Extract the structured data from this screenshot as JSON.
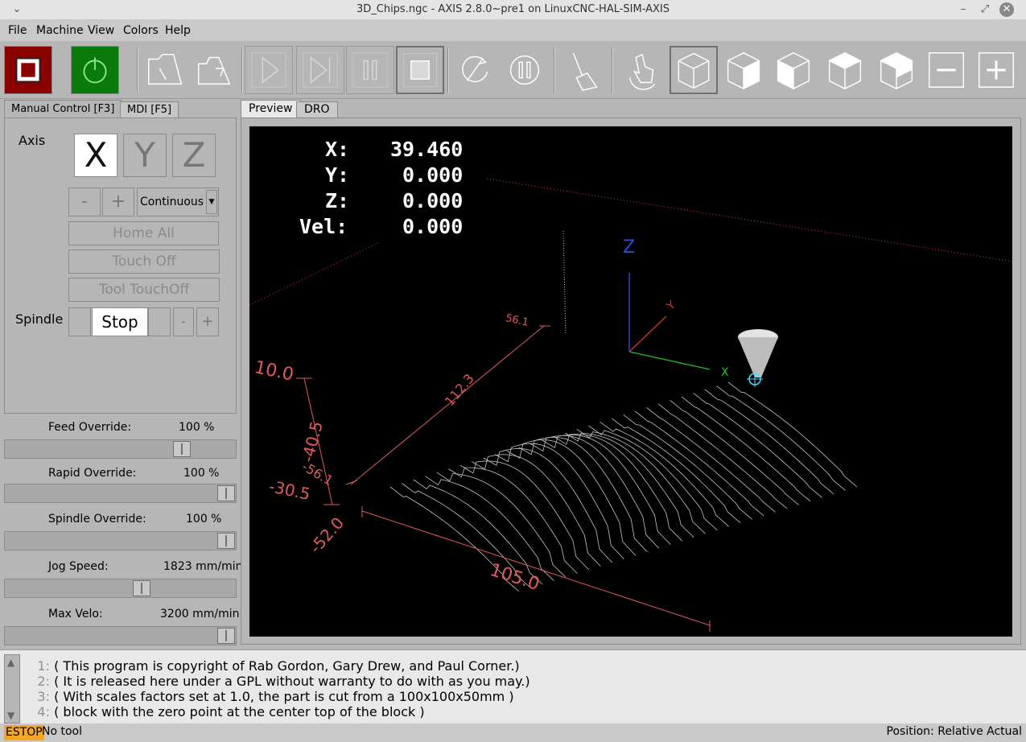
{
  "window": {
    "title": "3D_Chips.ngc - AXIS 2.8.0~pre1 on LinuxCNC-HAL-SIM-AXIS"
  },
  "menu": [
    {
      "label": "File"
    },
    {
      "label": "Machine"
    },
    {
      "label": "View"
    },
    {
      "label": "Colors"
    },
    {
      "label": "Help"
    }
  ],
  "toolbar": {
    "buttons": [
      "estop-icon",
      "power-icon",
      "open-file-icon",
      "reload-file-icon",
      "run-icon",
      "step-icon",
      "pause-icon",
      "stop-icon",
      "skip-block-icon",
      "optional-pause-icon",
      "clear-backplot-icon",
      "touch-zoom-icon",
      "view-perspective-icon",
      "view-x-icon",
      "view-y-icon",
      "view-z-icon",
      "view-p-icon",
      "zoom-out-icon",
      "zoom-in-icon"
    ]
  },
  "left_tabs": [
    {
      "label": "Manual Control [F3]"
    },
    {
      "label": "MDI [F5]"
    }
  ],
  "manual": {
    "axis_label": "Axis",
    "axes": [
      "X",
      "Y",
      "Z"
    ],
    "selected_axis": "X",
    "jog_minus": "-",
    "jog_plus": "+",
    "jog_mode": "Continuous",
    "home_all": "Home All",
    "touch_off": "Touch Off",
    "tool_touchoff": "Tool TouchOff",
    "spindle_label": "Spindle",
    "spindle_stop": "Stop",
    "spindle_minus": "-",
    "spindle_plus": "+"
  },
  "sliders": [
    {
      "label": "Feed Override:",
      "value": "100 %",
      "fraction": 0.79
    },
    {
      "label": "Rapid Override:",
      "value": "100 %",
      "fraction": 1.0
    },
    {
      "label": "Spindle Override:",
      "value": "100 %",
      "fraction": 1.0
    },
    {
      "label": "Jog Speed:",
      "value": "1823 mm/min",
      "fraction": 0.6
    },
    {
      "label": "Max Velo:",
      "value": "3200 mm/min",
      "fraction": 1.0
    }
  ],
  "preview_tabs": [
    {
      "label": "Preview"
    },
    {
      "label": "DRO"
    }
  ],
  "dro": {
    "x_label": "X:",
    "x_value": "39.460",
    "y_label": "Y:",
    "y_value": "0.000",
    "z_label": "Z:",
    "z_value": "0.000",
    "vel_label": "Vel:",
    "vel_value": "0.000"
  },
  "preview_labels": {
    "z_axis": "Z",
    "y_axis": "Y",
    "x_axis": "X",
    "dim_z_top": "10.0",
    "dim_z_mid": "-40.5",
    "dim_z_bottom": "-30.5",
    "dim_y_a": "56.1",
    "dim_y_b": "112.3",
    "dim_y_c": "-56.1",
    "dim_x_left": "-52.0",
    "dim_x_len": "105.0"
  },
  "gcode": [
    {
      "num": "1:",
      "text": "( This program is copyright of Rab Gordon, Gary Drew, and Paul Corner.)"
    },
    {
      "num": "2:",
      "text": "( It is released here under a GPL without warranty to do with as you may.)"
    },
    {
      "num": "3:",
      "text": "( With scales factors set at 1.0, the part is cut from a 100x100x50mm )"
    },
    {
      "num": "4:",
      "text": "( block with the zero point at the center top of the block )"
    }
  ],
  "status": {
    "estop": "ESTOP",
    "tool": "No tool",
    "position": "Position: Relative Actual"
  },
  "colors": {
    "estop_red": "#8b0000",
    "power_green": "#0a7a0a",
    "estop_badge": "#f5a623",
    "dim_line": "#e05a5a"
  }
}
